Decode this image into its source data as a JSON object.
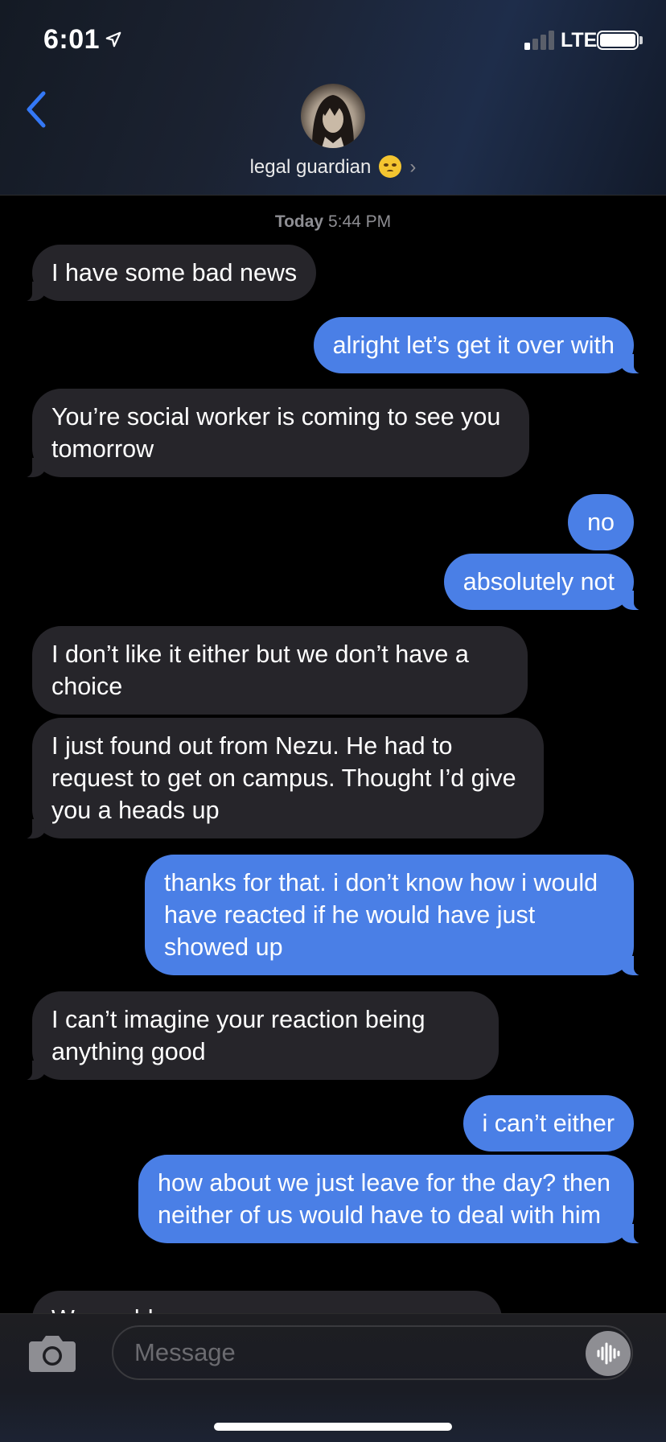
{
  "status_bar": {
    "time": "6:01",
    "network": "LTE"
  },
  "header": {
    "contact_name": "legal guardian",
    "contact_emoji": "🥺-face-icon",
    "chevron": "›"
  },
  "thread": {
    "timestamp_day": "Today",
    "timestamp_time": "5:44 PM",
    "messages": [
      {
        "direction": "in",
        "text": "I have some bad news"
      },
      {
        "direction": "out",
        "text": "alright let’s get it over with"
      },
      {
        "direction": "in",
        "text": "You’re social worker is coming to see you tomorrow"
      },
      {
        "direction": "out",
        "text": "no"
      },
      {
        "direction": "out",
        "text": "absolutely not"
      },
      {
        "direction": "in",
        "text": "I don’t like it either but we don’t have a choice"
      },
      {
        "direction": "in",
        "text": "I just found out from Nezu. He had to request to get on campus. Thought I’d give you a heads up"
      },
      {
        "direction": "out",
        "text": "thanks for that. i don’t know how i would have reacted if he would have just showed up"
      },
      {
        "direction": "in",
        "text": "I can’t imagine your reaction being anything good"
      },
      {
        "direction": "out",
        "text": "i can’t either"
      },
      {
        "direction": "out",
        "text": "how about we just leave for the day? then neither of us would have to deal with him"
      },
      {
        "direction": "in",
        "text": "We could ... "
      }
    ]
  },
  "input_bar": {
    "placeholder": "Message"
  },
  "colors": {
    "incoming_bubble": "#26252a",
    "outgoing_bubble": "#4a7fe6",
    "accent": "#3478f6"
  }
}
